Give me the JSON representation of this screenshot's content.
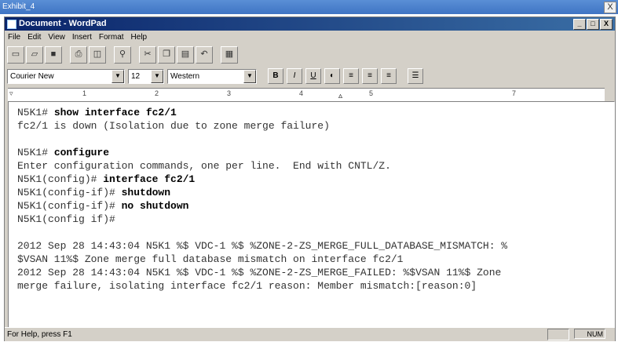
{
  "outer_window": {
    "title": "Exhibit_4",
    "close_label": "X"
  },
  "app": {
    "title": "Document - WordPad",
    "min_label": "_",
    "max_label": "□",
    "close_label": "X"
  },
  "menu": {
    "items": [
      "File",
      "Edit",
      "View",
      "Insert",
      "Format",
      "Help"
    ]
  },
  "toolbar": {
    "buttons": [
      "new-document-icon",
      "open-folder-icon",
      "save-icon",
      "print-icon",
      "print-preview-icon",
      "find-icon",
      "cut-icon",
      "copy-icon",
      "paste-icon",
      "undo-icon",
      "date-time-icon"
    ]
  },
  "format_bar": {
    "font": "Courier New",
    "size": "12",
    "script": "Western",
    "bold": "B",
    "italic": "I",
    "underline": "U"
  },
  "ruler": {
    "marks": [
      "1",
      "2",
      "3",
      "4",
      "5",
      "7"
    ]
  },
  "document": {
    "lines": [
      {
        "prompt": "N5K1# ",
        "cmd": "show interface fc2/1"
      },
      {
        "prompt": "fc2/1 is down (Isolation due to zone merge failure)",
        "cmd": ""
      },
      {
        "prompt": "",
        "cmd": ""
      },
      {
        "prompt": "N5K1# ",
        "cmd": "configure"
      },
      {
        "prompt": "Enter configuration commands, one per line.  End with CNTL/Z.",
        "cmd": ""
      },
      {
        "prompt": "N5K1(config)# ",
        "cmd": "interface fc2/1"
      },
      {
        "prompt": "N5K1(config-if)# ",
        "cmd": "shutdown"
      },
      {
        "prompt": "N5K1(config-if)# ",
        "cmd": "no shutdown"
      },
      {
        "prompt": "N5K1(config if)#",
        "cmd": ""
      },
      {
        "prompt": "",
        "cmd": ""
      },
      {
        "prompt": "2012 Sep 28 14:43:04 N5K1 %$ VDC-1 %$ %ZONE-2-ZS_MERGE_FULL_DATABASE_MISMATCH: %",
        "cmd": ""
      },
      {
        "prompt": "$VSAN 11%$ Zone merge full database mismatch on interface fc2/1",
        "cmd": ""
      },
      {
        "prompt": "2012 Sep 28 14:43:04 N5K1 %$ VDC-1 %$ %ZONE-2-ZS_MERGE_FAILED: %$VSAN 11%$ Zone",
        "cmd": ""
      },
      {
        "prompt": "merge failure, isolating interface fc2/1 reason: Member mismatch:[reason:0]",
        "cmd": ""
      }
    ]
  },
  "status": {
    "text": "For Help, press F1",
    "num": "NUM"
  }
}
